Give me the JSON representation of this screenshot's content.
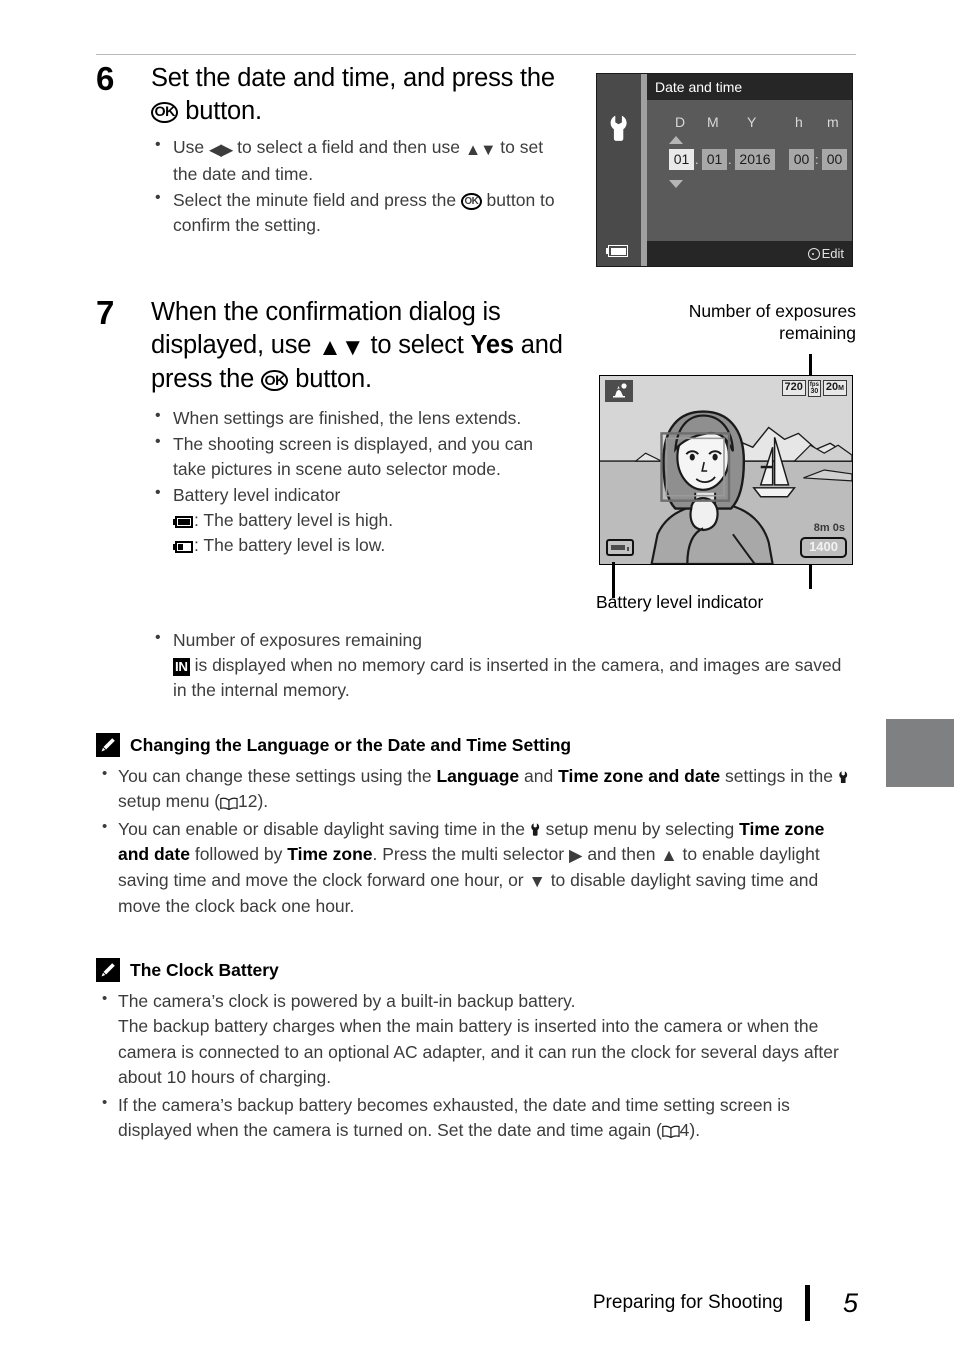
{
  "page": {
    "footer_section": "Preparing for Shooting",
    "footer_page_number": "5"
  },
  "steps": [
    {
      "number": "6",
      "heading_part1": "Set the date and time, and press the ",
      "heading_ok": "OK",
      "heading_part2": " button.",
      "bullets": [
        {
          "pre": "Use ",
          "glyph": "left-right-arrows",
          "mid": " to select a field and then use ",
          "glyph2": "up-down-arrows",
          "post": " to set the date and time."
        },
        {
          "pre": "Select the minute field and press the ",
          "glyph": "ok-button",
          "post": " button to confirm the setting."
        }
      ]
    },
    {
      "number": "7",
      "heading_part1": "When the confirmation dialog is displayed, use ",
      "heading_arrows": "up-down-arrows",
      "heading_part2": " to select ",
      "heading_yes": "Yes",
      "heading_part3": " and press the ",
      "heading_ok": "OK",
      "heading_part4": " button.",
      "bullets": [
        {
          "text": "When settings are finished, the lens extends."
        },
        {
          "text": "The shooting screen is displayed, and you can take pictures in scene auto selector mode."
        },
        {
          "text": "Battery level indicator",
          "sublines": [
            {
              "icon": "battery-high",
              "text": ": The battery level is high."
            },
            {
              "icon": "battery-low",
              "text": ": The battery level is low."
            }
          ]
        },
        {
          "text": "Number of exposures remaining",
          "sublines": [
            {
              "icon": "internal-memory",
              "text": " is displayed when no memory card is inserted in the camera, and images are saved in the internal memory."
            }
          ]
        }
      ]
    }
  ],
  "date_time_screen": {
    "title": "Date and time",
    "menu_icon": "wrench-icon",
    "battery_icon": "battery-icon",
    "column_labels": [
      "D",
      "M",
      "Y",
      "h",
      "m"
    ],
    "fields": [
      {
        "value": "01",
        "selected": true
      },
      {
        "value": "01",
        "selected": false
      },
      {
        "value": "2016",
        "selected": false
      },
      {
        "value": "00",
        "selected": false
      },
      {
        "value": "00",
        "selected": false
      }
    ],
    "separators": [
      ".",
      ".",
      ":"
    ],
    "footer_hint": "Edit",
    "footer_icon": "multi-selector-icon",
    "up_arrow": "up-arrow-icon",
    "down_arrow": "down-arrow-icon"
  },
  "shooting_screen": {
    "callout_top": "Number of exposures\nremaining",
    "callout_top_line1": "Number of exposures",
    "callout_top_line2": "remaining",
    "callout_bottom": "Battery level indicator",
    "scene_mode_icon": "scene-auto-selector-icon",
    "movie_size": "720",
    "frame_rate": "30",
    "frame_rate_unit": "fps",
    "image_size": "20",
    "image_size_unit": "M",
    "movie_time_remaining": "8m 0s",
    "exposures_remaining": "1400",
    "battery_icon": "battery-icon",
    "face_detection_frame": "face-detection-frame"
  },
  "notes": [
    {
      "icon": "pencil-note-icon",
      "title": "Changing the Language or the Date and Time Setting",
      "bullets": [
        {
          "segments": [
            {
              "t": "You can change these settings using the "
            },
            {
              "t": "Language",
              "bold": true
            },
            {
              "t": " and "
            },
            {
              "t": "Time zone and date",
              "bold": true
            },
            {
              "t": " settings in the "
            },
            {
              "t": "",
              "icon": "wrench-icon"
            },
            {
              "t": " setup menu ("
            },
            {
              "t": "",
              "icon": "book-icon"
            },
            {
              "t": "12)."
            }
          ]
        },
        {
          "segments": [
            {
              "t": "You can enable or disable daylight saving time in the "
            },
            {
              "t": "",
              "icon": "wrench-icon"
            },
            {
              "t": " setup menu by selecting "
            },
            {
              "t": "Time zone and date",
              "bold": true
            },
            {
              "t": " followed by "
            },
            {
              "t": "Time zone",
              "bold": true
            },
            {
              "t": ". Press the multi selector "
            },
            {
              "t": "",
              "icon": "right-arrow-icon"
            },
            {
              "t": " and then "
            },
            {
              "t": "",
              "icon": "up-arrow-icon"
            },
            {
              "t": " to enable daylight saving time and move the clock forward one hour, or "
            },
            {
              "t": "",
              "icon": "down-arrow-icon"
            },
            {
              "t": " to disable daylight saving time and move the clock back one hour."
            }
          ]
        }
      ]
    },
    {
      "icon": "pencil-note-icon",
      "title": "The Clock Battery",
      "bullets": [
        {
          "segments": [
            {
              "t": "The camera’s clock is powered by a built-in backup battery."
            },
            {
              "t": "",
              "break": true
            },
            {
              "t": "The backup battery charges when the main battery is inserted into the camera or when the camera is connected to an optional AC adapter, and it can run the clock for several days after about 10 hours of charging."
            }
          ]
        },
        {
          "segments": [
            {
              "t": "If the camera’s backup battery becomes exhausted, the date and time setting screen is displayed when the camera is turned on. Set the date and time again ("
            },
            {
              "t": "",
              "icon": "book-icon"
            },
            {
              "t": "4)."
            }
          ]
        }
      ]
    }
  ],
  "colors": {
    "body_text": "#3c3c3c",
    "heading_text": "#000000",
    "thumb_tab": "#7f8081",
    "screen_bg": "#5a5a5a",
    "screen_sidebar": "#4a4a4a",
    "screen_titlebar": "#262626",
    "field_selected": "#e9e9e9",
    "field_normal": "#a8a8a8"
  }
}
